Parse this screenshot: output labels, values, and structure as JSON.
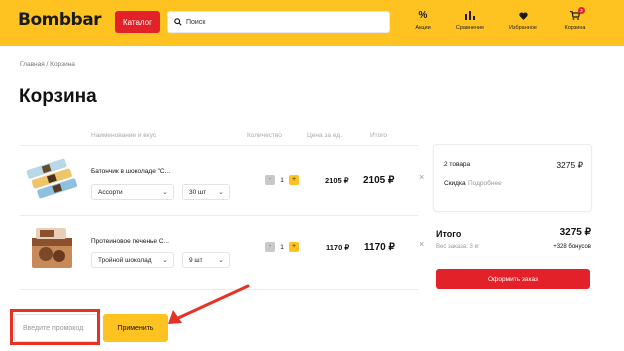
{
  "header": {
    "logo": "Bombbar",
    "catalog_label": "Каталог",
    "search_placeholder": "Поиск",
    "nav": {
      "promo": {
        "icon": "percent-icon",
        "label": "Акции"
      },
      "compare": {
        "icon": "bar-chart-icon",
        "label": "Сравнение"
      },
      "favorites": {
        "icon": "heart-icon",
        "label": "Избранное"
      },
      "cart": {
        "icon": "cart-icon",
        "label": "Корзина",
        "badge": "2"
      }
    }
  },
  "breadcrumb": "Главная / Корзина",
  "page_title": "Корзина",
  "table": {
    "headers": {
      "name": "Наименование и вкус",
      "qty": "Количество",
      "unit_price": "Цена за ед.",
      "total": "Итого"
    },
    "rows": [
      {
        "name": "Батончик в шоколаде \"С...",
        "flavor": "Ассорти",
        "pack": "30 шт",
        "qty": "1",
        "unit_price": "2105 ₽",
        "total": "2105 ₽"
      },
      {
        "name": "Протеиновое печенье С...",
        "flavor": "Тройной шоколад",
        "pack": "9 шт",
        "qty": "1",
        "unit_price": "1170 ₽",
        "total": "1170 ₽"
      }
    ],
    "minus": "-",
    "plus": "+",
    "remove": "×"
  },
  "promo": {
    "placeholder": "Введите промокод",
    "apply_label": "Применить"
  },
  "summary": {
    "count": "2 товара",
    "amount": "3275 ₽",
    "discount_label": "Скидка",
    "details_link": "Подробнее",
    "total_label": "Итого",
    "total_amount": "3275 ₽",
    "weight": "Вес заказа: 3 кг",
    "bonus": "+328 бонусов",
    "order_label": "Оформить заказ"
  },
  "colors": {
    "brand_yellow": "#ffc321",
    "accent_red": "#e32128",
    "annotation_red": "#e53224"
  }
}
